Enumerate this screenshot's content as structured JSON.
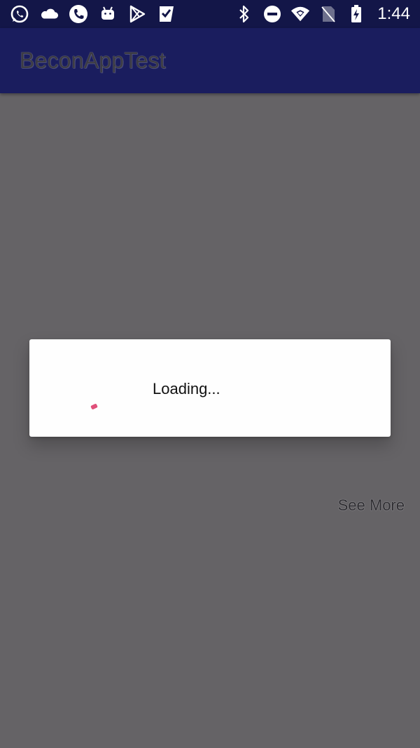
{
  "status_bar": {
    "left_icons": [
      "whatsapp-icon",
      "cloud-icon",
      "phone-icon",
      "android-icon",
      "play-store-icon",
      "checkmark-icon"
    ],
    "right_icons": [
      "bluetooth-icon",
      "do-not-disturb-icon",
      "wifi-icon",
      "no-sim-icon",
      "battery-icon"
    ],
    "time": "1:44"
  },
  "app_bar": {
    "title": "BeconAppTest"
  },
  "content": {
    "see_more_label": "See More"
  },
  "dialog": {
    "message": "Loading...",
    "spinner_color": "#e0507a"
  },
  "colors": {
    "status_bar": "#131648",
    "app_bar": "#1a1d5e",
    "scrim_background": "#656366",
    "dialog_background": "#fefefe"
  }
}
